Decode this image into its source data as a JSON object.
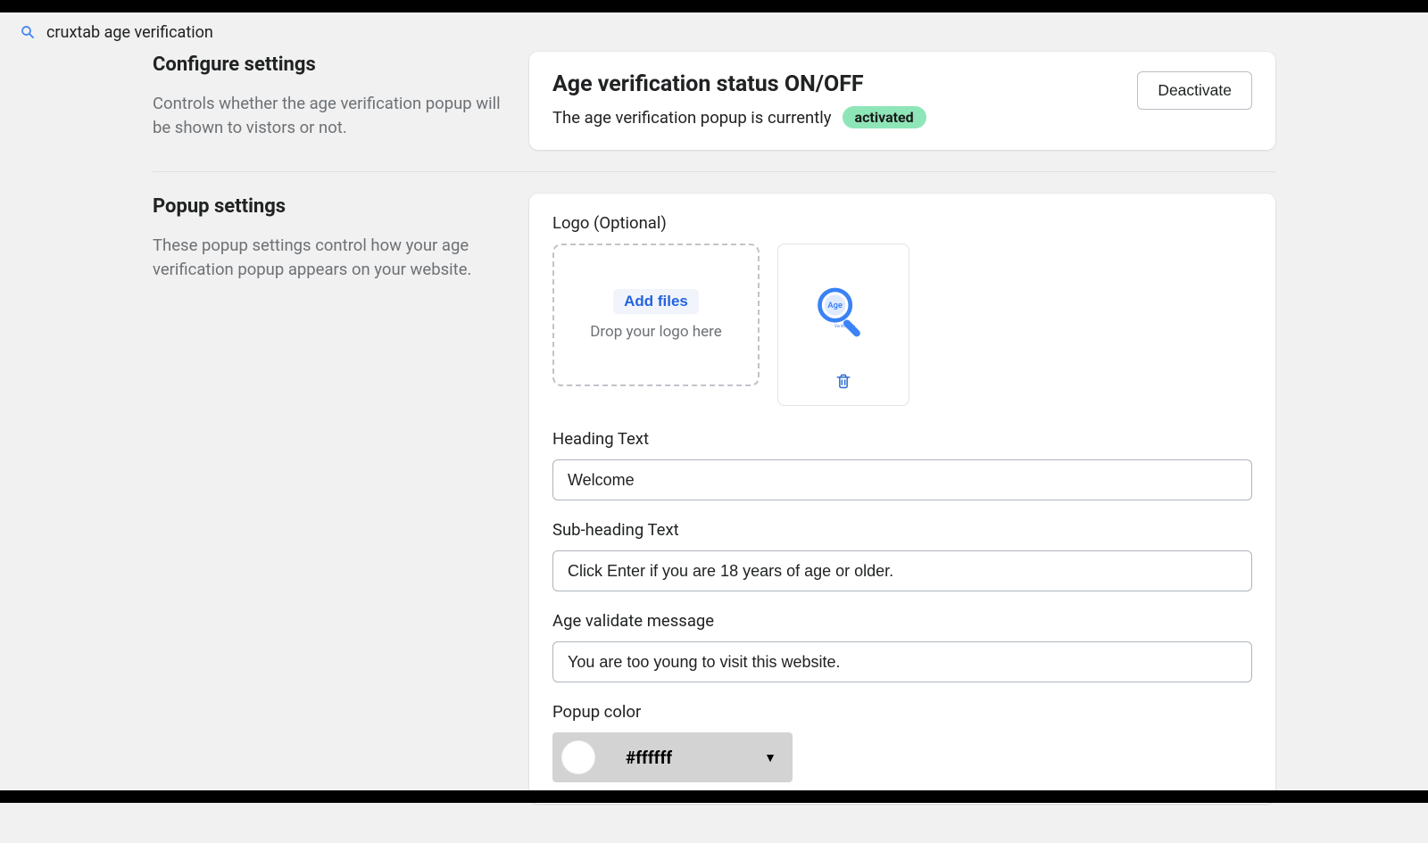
{
  "breadcrumb": {
    "text": "cruxtab age verification"
  },
  "configure": {
    "heading": "Configure settings",
    "desc": "Controls whether the age verification popup will be shown to vistors or not."
  },
  "status_card": {
    "title": "Age verification status ON/OFF",
    "prefix": "The age verification popup is currently",
    "badge": "activated",
    "deactivate_label": "Deactivate"
  },
  "popup_section": {
    "heading": "Popup settings",
    "desc": "These popup settings control how your age verification popup appears on your website."
  },
  "logo": {
    "label": "Logo (Optional)",
    "add_files_label": "Add files",
    "drop_hint": "Drop your logo here",
    "preview_caption_top": "Age",
    "preview_caption_bottom": "Verification"
  },
  "fields": {
    "heading_label": "Heading Text",
    "heading_value": "Welcome",
    "subheading_label": "Sub-heading Text",
    "subheading_value": "Click Enter if you are 18 years of age or older.",
    "validate_label": "Age validate message",
    "validate_value": "You are too young to visit this website.",
    "popup_color_label": "Popup color",
    "popup_color_value": "#ffffff"
  }
}
